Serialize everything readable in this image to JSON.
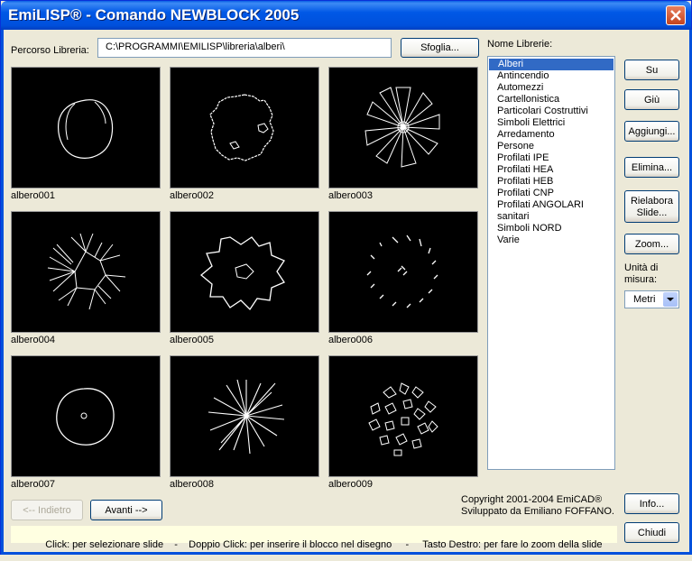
{
  "window": {
    "title": "EmiLISP® - Comando NEWBLOCK 2005"
  },
  "library": {
    "path_label": "Percorso Libreria:",
    "path_value": "C:\\PROGRAMMI\\EMILISP\\libreria\\alberi\\",
    "browse_label": "Sfoglia..."
  },
  "thumbnails": [
    {
      "label": "albero001"
    },
    {
      "label": "albero002"
    },
    {
      "label": "albero003"
    },
    {
      "label": "albero004"
    },
    {
      "label": "albero005"
    },
    {
      "label": "albero006"
    },
    {
      "label": "albero007"
    },
    {
      "label": "albero008"
    },
    {
      "label": "albero009"
    }
  ],
  "libraries": {
    "header": "Nome Librerie:",
    "items": [
      "Alberi",
      "Antincendio",
      "Automezzi",
      "Cartellonistica",
      "Particolari Costruttivi",
      "Simboli Elettrici",
      "Arredamento",
      "Persone",
      "Profilati IPE",
      "Profilati HEA",
      "Profilati HEB",
      "Profilati CNP",
      "Profilati ANGOLARI",
      "sanitari",
      "Simboli NORD",
      "Varie"
    ],
    "selected": "Alberi"
  },
  "side_buttons": {
    "up": "Su",
    "down": "Giù",
    "add": "Aggiungi...",
    "delete": "Elimina...",
    "rework_line1": "Rielabora",
    "rework_line2": "Slide...",
    "zoom": "Zoom..."
  },
  "units": {
    "label_line1": "Unità di",
    "label_line2": "misura:",
    "value": "Metri"
  },
  "nav": {
    "prev": "<-- Indietro",
    "next": "Avanti -->"
  },
  "copyright": {
    "line1": "Copyright 2001-2004 EmiCAD®",
    "line2": "Sviluppato da Emiliano FOFFANO."
  },
  "footer_buttons": {
    "info": "Info...",
    "close": "Chiudi"
  },
  "status": {
    "text": "Click: per selezionare slide    -    Doppio Click: per inserire il blocco nel disegno     -     Tasto Destro: per fare lo zoom della slide"
  },
  "colors": {
    "title_blue": "#0054E3",
    "selection": "#316AC5",
    "slide_bg": "#000000",
    "status_bg": "#FFFFE1"
  }
}
